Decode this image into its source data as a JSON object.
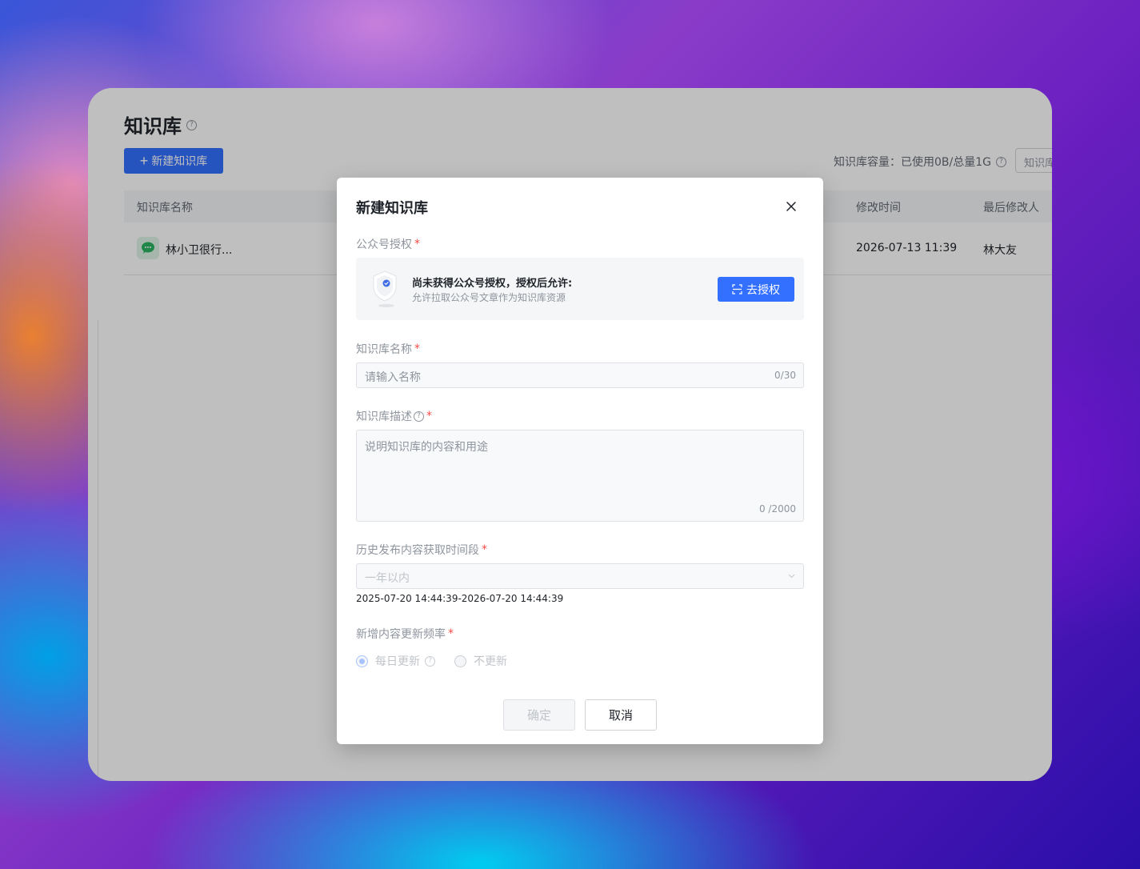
{
  "app": {
    "title": "知识库",
    "new_button": "新建知识库",
    "capacity": "知识库容量：已使用0B/总量1G",
    "filter_placeholder": "知识库",
    "columns": [
      "知识库名称",
      "修改时间",
      "最后修改人"
    ],
    "rows": [
      {
        "name": "林小卫很行...",
        "modified": "2026-07-13 11:39",
        "modifier": "林大友"
      }
    ]
  },
  "modal": {
    "title": "新建知识库",
    "auth_label": "公众号授权",
    "auth_title": "尚未获得公众号授权，授权后允许:",
    "auth_sub": "允许拉取公众号文章作为知识库资源",
    "auth_button": "去授权",
    "name_label": "知识库名称",
    "name_placeholder": "请输入名称",
    "name_counter": "0/30",
    "desc_label": "知识库描述",
    "desc_placeholder": "说明知识库的内容和用途",
    "desc_counter": "0 /2000",
    "period_label": "历史发布内容获取时间段",
    "period_value": "一年以内",
    "period_range": "2025-07-20 14:44:39-2026-07-20 14:44:39",
    "freq_label": "新增内容更新频率",
    "freq_options": [
      "每日更新",
      "不更新"
    ],
    "freq_selected": "每日更新",
    "ok_button": "确定",
    "cancel_button": "取消"
  },
  "colors": {
    "primary": "#3370ff",
    "required": "#f54a45",
    "wechat_green": "#2bb35f"
  }
}
